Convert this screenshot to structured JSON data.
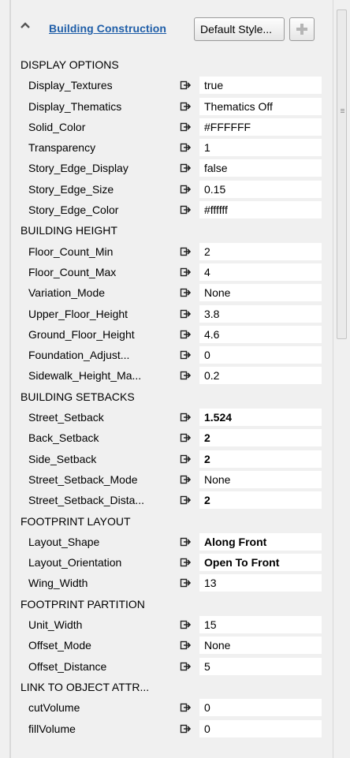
{
  "header": {
    "title": "Building Construction",
    "style_button": "Default Style...",
    "add_icon": "plus-icon",
    "collapse_icon": "chevron-up-icon"
  },
  "link_icon": "link-connector-icon",
  "sections": [
    {
      "label": "DISPLAY OPTIONS",
      "rows": [
        {
          "key": "Display_Textures",
          "value": "true",
          "bold": false
        },
        {
          "key": "Display_Thematics",
          "value": "Thematics Off",
          "bold": false
        },
        {
          "key": "Solid_Color",
          "value": "#FFFFFF",
          "bold": false
        },
        {
          "key": "Transparency",
          "value": "1",
          "bold": false
        },
        {
          "key": "Story_Edge_Display",
          "value": "false",
          "bold": false
        },
        {
          "key": "Story_Edge_Size",
          "value": "0.15",
          "bold": false
        },
        {
          "key": "Story_Edge_Color",
          "value": "#ffffff",
          "bold": false
        }
      ]
    },
    {
      "label": "BUILDING HEIGHT",
      "rows": [
        {
          "key": "Floor_Count_Min",
          "value": "2",
          "bold": false
        },
        {
          "key": "Floor_Count_Max",
          "value": "4",
          "bold": false
        },
        {
          "key": "Variation_Mode",
          "value": "None",
          "bold": false
        },
        {
          "key": "Upper_Floor_Height",
          "value": "3.8",
          "bold": false
        },
        {
          "key": "Ground_Floor_Height",
          "value": "4.6",
          "bold": false
        },
        {
          "key": "Foundation_Adjust...",
          "value": "0",
          "bold": false
        },
        {
          "key": "Sidewalk_Height_Ma...",
          "value": "0.2",
          "bold": false
        }
      ]
    },
    {
      "label": "BUILDING SETBACKS",
      "rows": [
        {
          "key": "Street_Setback",
          "value": "1.524",
          "bold": true
        },
        {
          "key": "Back_Setback",
          "value": "2",
          "bold": true
        },
        {
          "key": "Side_Setback",
          "value": "2",
          "bold": true
        },
        {
          "key": "Street_Setback_Mode",
          "value": "None",
          "bold": false
        },
        {
          "key": "Street_Setback_Dista...",
          "value": "2",
          "bold": true
        }
      ]
    },
    {
      "label": "FOOTPRINT LAYOUT",
      "rows": [
        {
          "key": "Layout_Shape",
          "value": "Along Front",
          "bold": true
        },
        {
          "key": "Layout_Orientation",
          "value": "Open To Front",
          "bold": true
        },
        {
          "key": "Wing_Width",
          "value": "13",
          "bold": false
        }
      ]
    },
    {
      "label": "FOOTPRINT PARTITION",
      "rows": [
        {
          "key": "Unit_Width",
          "value": "15",
          "bold": false
        },
        {
          "key": "Offset_Mode",
          "value": "None",
          "bold": false
        },
        {
          "key": "Offset_Distance",
          "value": "5",
          "bold": false
        }
      ]
    },
    {
      "label": "LINK TO OBJECT ATTR...",
      "rows": [
        {
          "key": "cutVolume",
          "value": "0",
          "bold": false
        },
        {
          "key": "fillVolume",
          "value": "0",
          "bold": false
        }
      ]
    }
  ]
}
